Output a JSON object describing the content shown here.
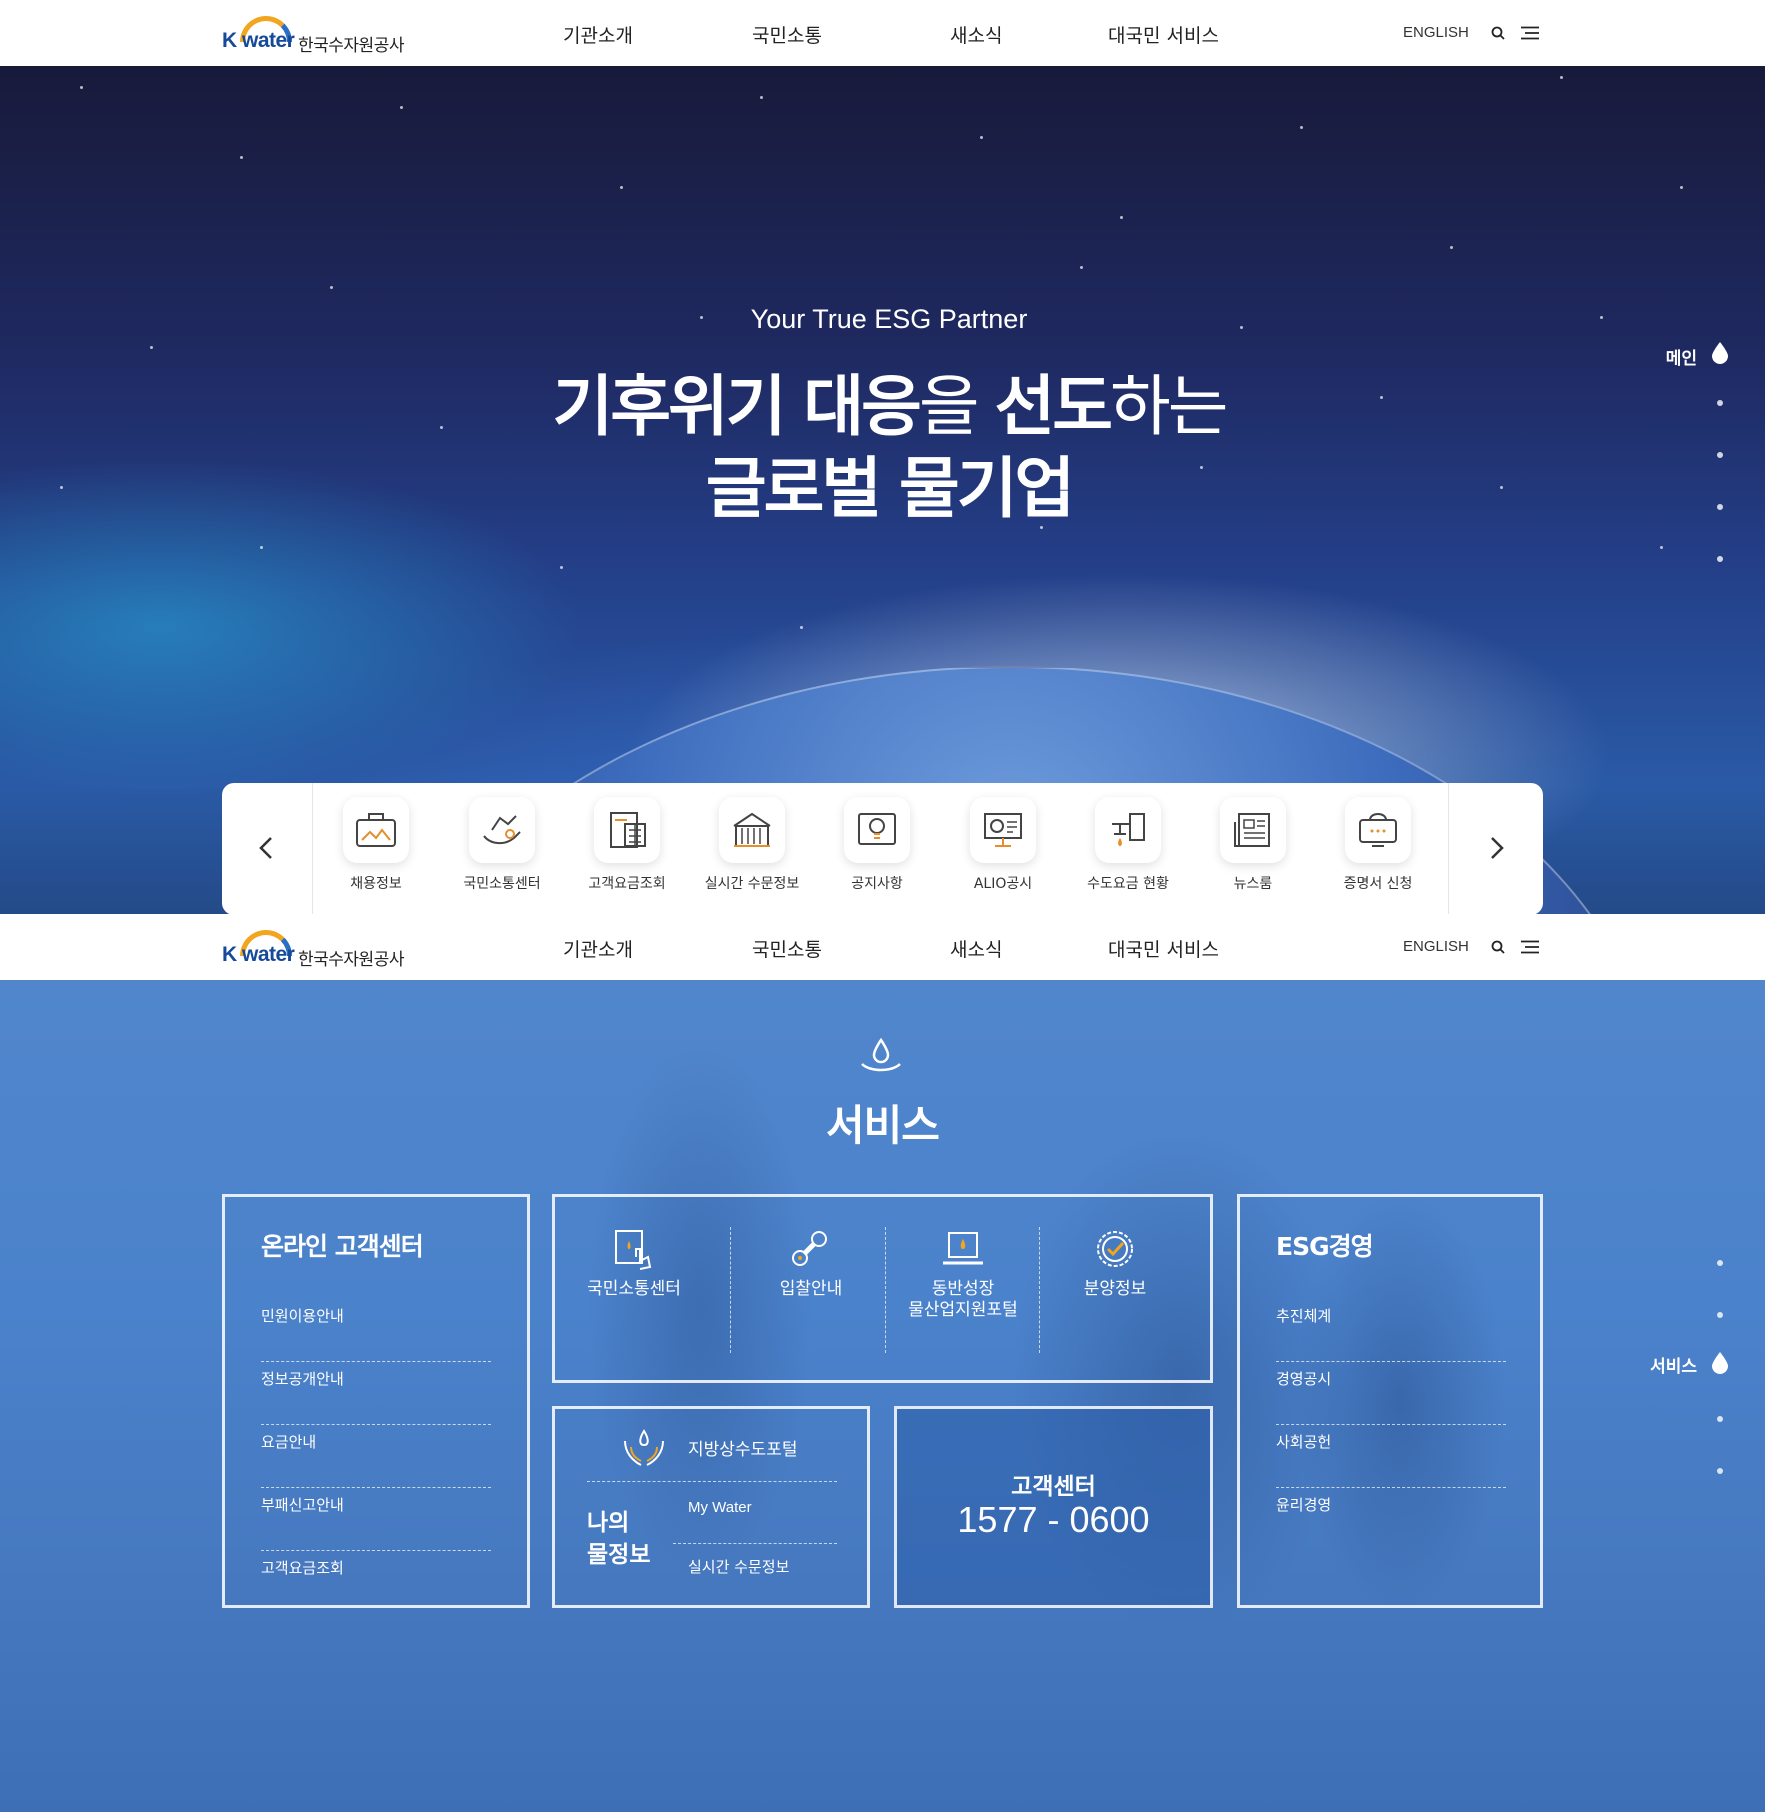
{
  "header": {
    "logo_en": "K water",
    "logo_ko": "한국수자원공사",
    "nav": [
      "기관소개",
      "국민소통",
      "새소식",
      "대국민 서비스"
    ],
    "english": "ENGLISH"
  },
  "hero": {
    "subtitle": "Your True ESG Partner",
    "title_line1_a": "기후위기 대응",
    "title_line1_b": "을 ",
    "title_line1_c": "선도",
    "title_line1_d": "하는",
    "title_line2": "글로벌 물기업",
    "side_label": "메인"
  },
  "quick_menu": {
    "items": [
      {
        "label": "채용정보",
        "icon": "briefcase-icon"
      },
      {
        "label": "국민소통센터",
        "icon": "handshake-icon"
      },
      {
        "label": "고객요금조회",
        "icon": "calculator-icon"
      },
      {
        "label": "실시간 수문정보",
        "icon": "dam-icon"
      },
      {
        "label": "공지사항",
        "icon": "idea-icon"
      },
      {
        "label": "ALIO공시",
        "icon": "presentation-icon"
      },
      {
        "label": "수도요금 현황",
        "icon": "faucet-icon"
      },
      {
        "label": "뉴스룸",
        "icon": "newspaper-icon"
      },
      {
        "label": "증명서 신청",
        "icon": "certificate-icon"
      }
    ]
  },
  "service": {
    "title": "서비스",
    "side_label": "서비스",
    "online_center": {
      "title": "온라인 고객센터",
      "links": [
        "민원이용안내",
        "정보공개안내",
        "요금안내",
        "부패신고안내",
        "고객요금조회"
      ]
    },
    "icon_links": [
      {
        "label": "국민소통센터",
        "icon": "tablet-touch-icon"
      },
      {
        "label": "입찰안내",
        "icon": "stamp-icon"
      },
      {
        "label": "동반성장\n물산업지원포털",
        "icon": "laptop-water-icon"
      },
      {
        "label": "분양정보",
        "icon": "badge-check-icon"
      }
    ],
    "my_water": {
      "title_1": "나의",
      "title_2": "물정보",
      "links": [
        "지방상수도포털",
        "My Water",
        "실시간 수문정보"
      ]
    },
    "customer_center": {
      "label": "고객센터",
      "phone": "1577 - 0600"
    },
    "esg": {
      "title": "ESG경영",
      "links": [
        "추진체계",
        "경영공시",
        "사회공헌",
        "윤리경영"
      ]
    }
  }
}
